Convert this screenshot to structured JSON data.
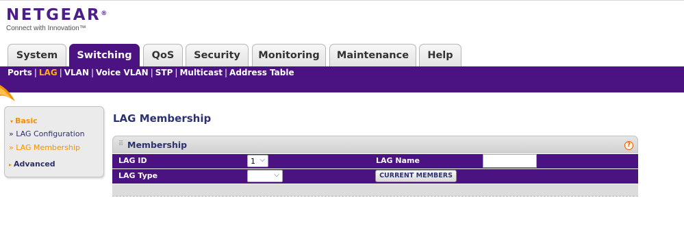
{
  "brand": {
    "name": "NETGEAR",
    "registered": "®",
    "tagline": "Connect with Innovation™"
  },
  "main_tabs": [
    {
      "label": "System"
    },
    {
      "label": "Switching"
    },
    {
      "label": "QoS"
    },
    {
      "label": "Security"
    },
    {
      "label": "Monitoring"
    },
    {
      "label": "Maintenance"
    },
    {
      "label": "Help"
    }
  ],
  "active_tab": "Switching",
  "sub_nav": [
    {
      "label": "Ports"
    },
    {
      "label": "LAG"
    },
    {
      "label": "VLAN"
    },
    {
      "label": "Voice VLAN"
    },
    {
      "label": "STP"
    },
    {
      "label": "Multicast"
    },
    {
      "label": "Address Table"
    }
  ],
  "sub_nav_separator": "|",
  "active_sub_nav": "LAG",
  "sidebar": {
    "basic_label": "Basic",
    "links": [
      {
        "label": "» LAG Configuration"
      },
      {
        "label": "» LAG Membership"
      }
    ],
    "advanced_label": "Advanced"
  },
  "page_title": "LAG Membership",
  "panel": {
    "title": "Membership",
    "help_icon": "?",
    "lag_id_label": "LAG ID",
    "lag_id_value": "1",
    "lag_name_label": "LAG Name",
    "lag_name_value": "",
    "lag_type_label": "LAG Type",
    "lag_type_value": "",
    "current_members_button": "CURRENT MEMBERS"
  },
  "colors": {
    "brand_purple": "#4b1282",
    "accent_orange": "#f39200",
    "active_subnav": "#ffaa1a",
    "heading_blue": "#2c3172"
  },
  "icons": {
    "dropdown": "chevron-down-icon",
    "help": "help-icon",
    "grip": "grip-icon"
  }
}
